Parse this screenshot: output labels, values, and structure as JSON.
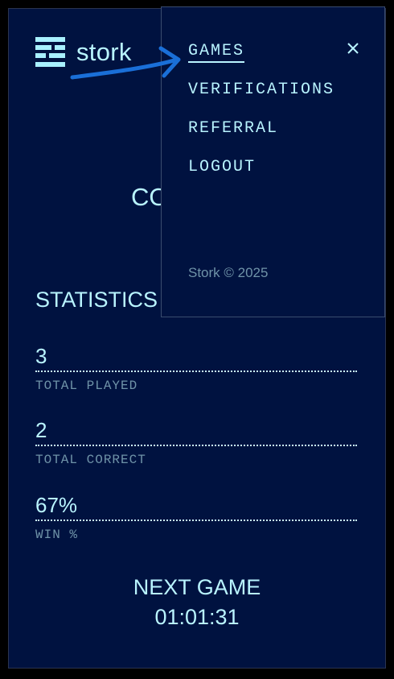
{
  "brand": {
    "name": "stork",
    "accent_color": "#b9f4ff",
    "background_color": "#001240"
  },
  "hero": {
    "partial_text": "CO"
  },
  "statistics": {
    "title": "STATISTICS",
    "items": [
      {
        "value": "3",
        "label": "TOTAL PLAYED"
      },
      {
        "value": "2",
        "label": "TOTAL CORRECT"
      },
      {
        "value": "67%",
        "label": "WIN %"
      }
    ]
  },
  "next_game": {
    "label": "NEXT GAME",
    "countdown": "01:01:31"
  },
  "menu": {
    "items": [
      {
        "label": "GAMES",
        "active": true
      },
      {
        "label": "VERIFICATIONS",
        "active": false
      },
      {
        "label": "REFERRAL",
        "active": false
      },
      {
        "label": "LOGOUT",
        "active": false
      }
    ],
    "close_icon": "close-icon",
    "copyright": "Stork © 2025"
  },
  "annotation": {
    "arrow_icon": "arrow-icon",
    "arrow_color": "#1a6fd8"
  }
}
